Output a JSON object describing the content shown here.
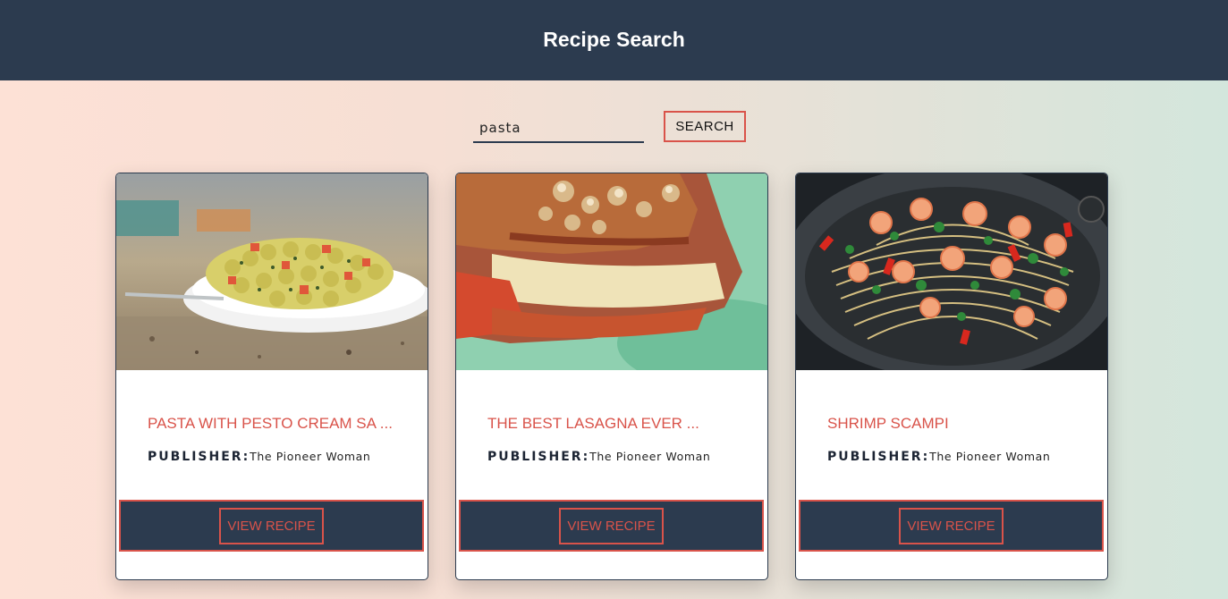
{
  "header": {
    "title": "Recipe Search"
  },
  "search": {
    "value": "pasta",
    "button_label": "SEARCH"
  },
  "cards": [
    {
      "title": "PASTA WITH PESTO CREAM SA ...",
      "publisher_label": "PUBLISHER:",
      "publisher": "The Pioneer Woman",
      "button_label": "VIEW RECIPE",
      "image": "pasta-salad-photo"
    },
    {
      "title": "THE BEST LASAGNA EVER ...",
      "publisher_label": "PUBLISHER:",
      "publisher": "The Pioneer Woman",
      "button_label": "VIEW RECIPE",
      "image": "lasagna-photo"
    },
    {
      "title": "SHRIMP SCAMPI",
      "publisher_label": "PUBLISHER:",
      "publisher": "The Pioneer Woman",
      "button_label": "VIEW RECIPE",
      "image": "shrimp-scampi-photo"
    }
  ],
  "colors": {
    "header_bg": "#2c3b4f",
    "accent": "#d9534a",
    "card_bg": "#ffffff"
  }
}
